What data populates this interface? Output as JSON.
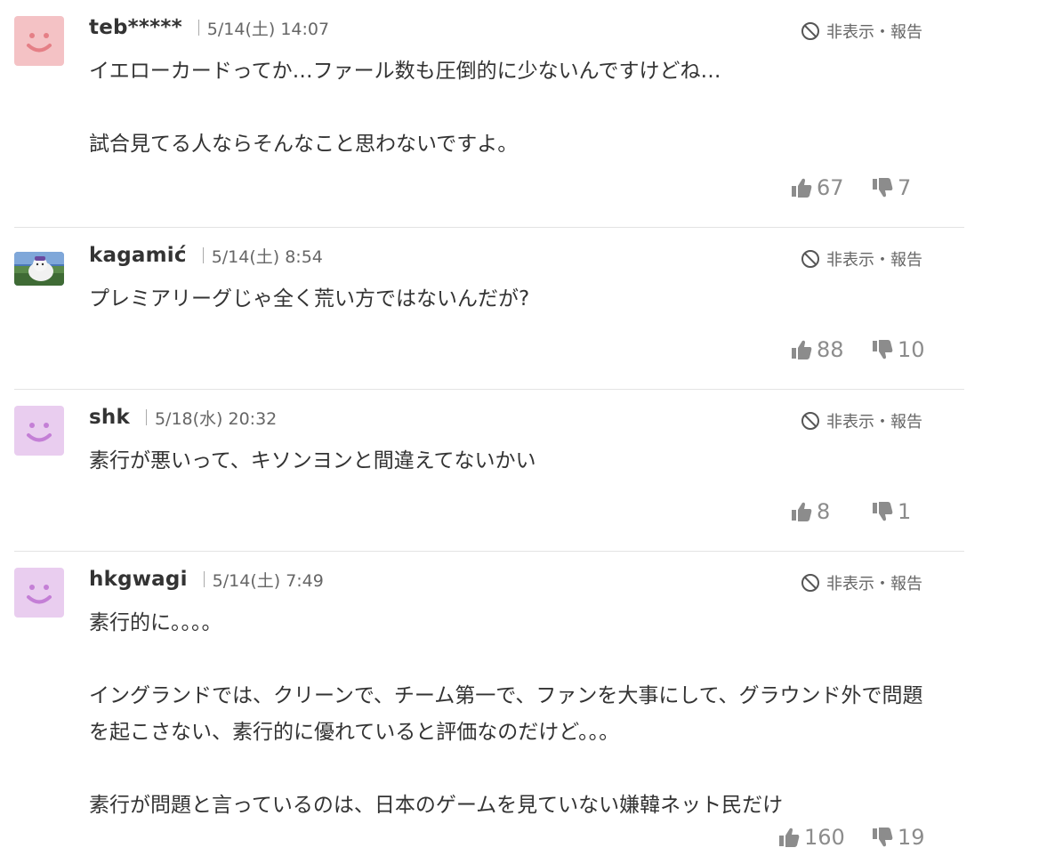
{
  "comments": [
    {
      "username": "teb*****",
      "timestamp": "5/14(土) 14:07",
      "hide_report_label": "非表示・報告",
      "avatar": "pink-smile-avatar",
      "avatar_color": "#f4c2c5",
      "avatar_face_color": "#e57f86",
      "body": "イエローカードってか…ファール数も圧倒的に少ないんですけどね…\n\n試合見てる人ならそんなこと思わないですよ。",
      "likes": "67",
      "dislikes": "7"
    },
    {
      "username": "kagamić",
      "timestamp": "5/14(土) 8:54",
      "hide_report_label": "非表示・報告",
      "avatar": "photo-avatar",
      "body": "プレミアリーグじゃ全く荒い方ではないんだが?",
      "likes": "88",
      "dislikes": "10"
    },
    {
      "username": "shk",
      "timestamp": "5/18(水) 20:32",
      "hide_report_label": "非表示・報告",
      "avatar": "purple-smile-avatar",
      "avatar_color": "#e9cdef",
      "avatar_face_color": "#c47fd6",
      "body": "素行が悪いって、キソンヨンと間違えてないかい",
      "likes": "8",
      "dislikes": "1"
    },
    {
      "username": "hkgwagi",
      "timestamp": "5/14(土) 7:49",
      "hide_report_label": "非表示・報告",
      "avatar": "purple-smile-avatar",
      "avatar_color": "#e9cdef",
      "avatar_face_color": "#c47fd6",
      "body": "素行的に。。。。\n\nイングランドでは、クリーンで、チーム第一で、ファンを大事にして、グラウンド外で問題を起こさない、素行的に優れていると評価なのだけど。。。\n\n素行が問題と言っているのは、日本のゲームを見ていない嫌韓ネット民だけ",
      "likes": "160",
      "dislikes": "19"
    }
  ],
  "icons": {
    "hide": "prohibited-icon",
    "like": "thumbs-up-icon",
    "dislike": "thumbs-down-icon"
  },
  "colors": {
    "text": "#333333",
    "meta": "#666666",
    "vote": "#8c8c8c",
    "divider": "#e3e3e3"
  }
}
